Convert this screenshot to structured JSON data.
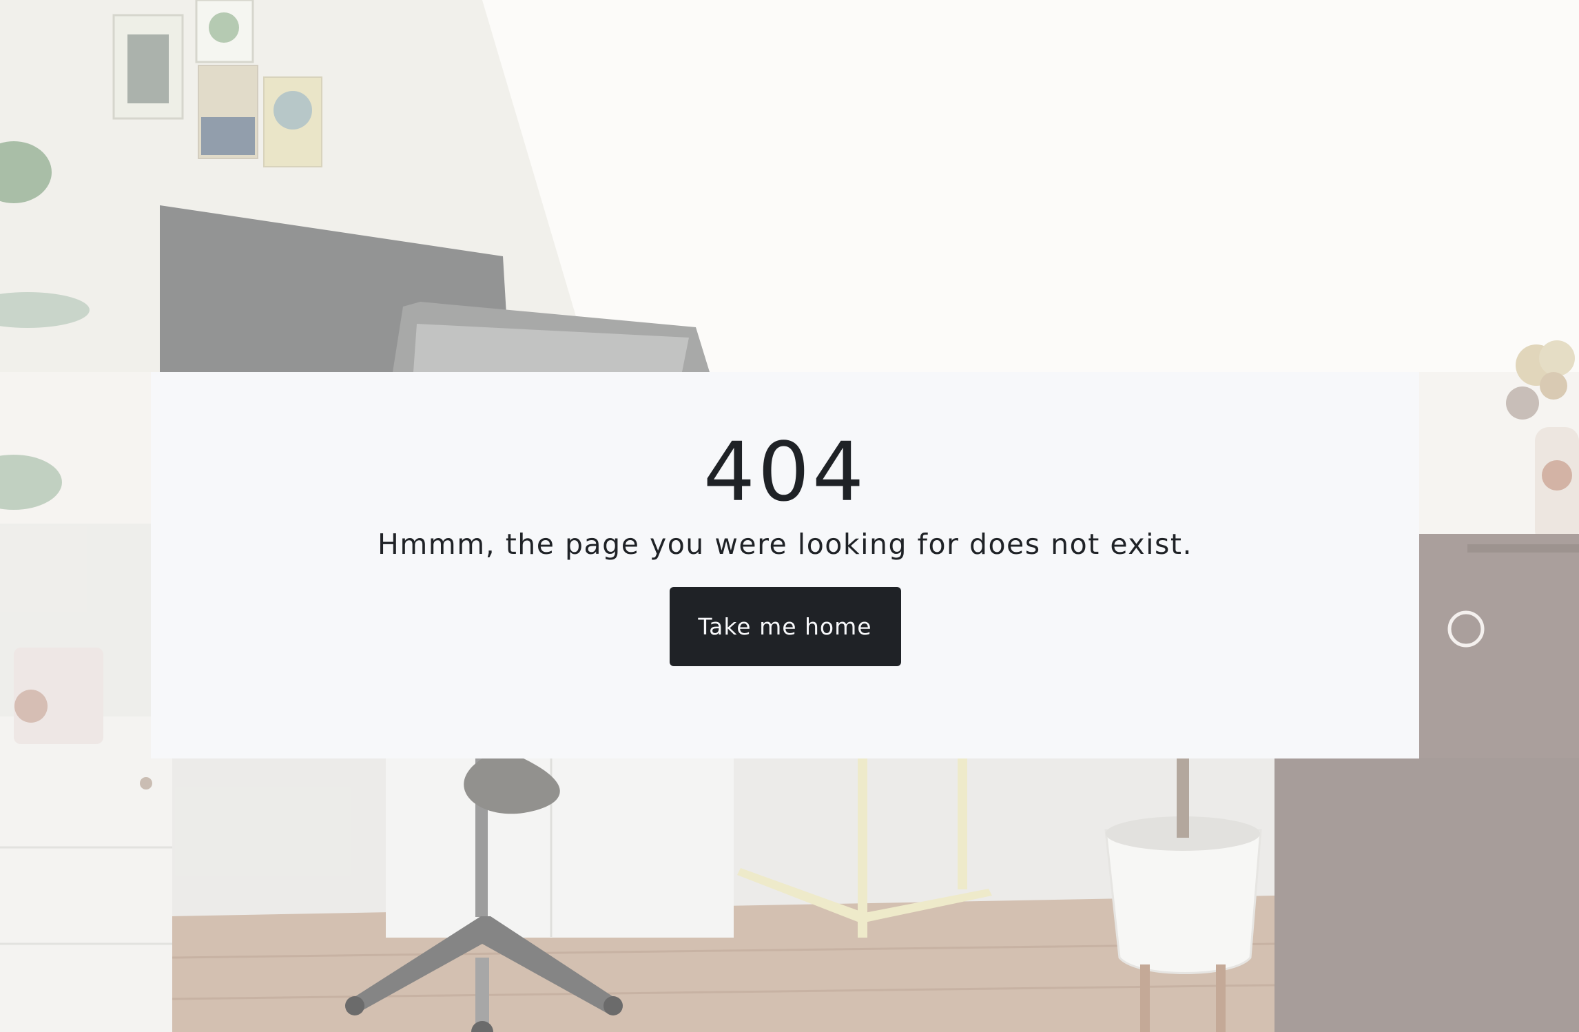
{
  "error": {
    "code": "404",
    "message": "Hmmm, the page you were looking for does not exist.",
    "button_label": "Take me home"
  },
  "colors": {
    "card_background": "#f7f8fa",
    "text": "#1f2226",
    "button_background": "#1f2226",
    "button_text": "#f7f8fa"
  },
  "background": {
    "description_icon": "office-room-photo"
  }
}
